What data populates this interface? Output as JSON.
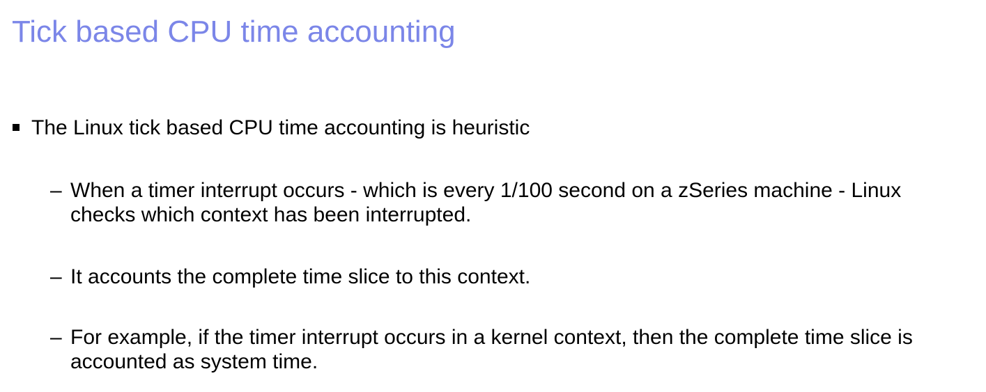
{
  "slide": {
    "title": "Tick based CPU time accounting",
    "title_color": "#7b86e8",
    "bullet": {
      "marker_icon": "square-bullet-icon",
      "text": "The Linux tick based CPU time accounting is heuristic",
      "sub_items": [
        {
          "dash": "–",
          "text": "When a timer interrupt occurs - which is every 1/100 second on a zSeries machine - Linux checks which context has been interrupted."
        },
        {
          "dash": "–",
          "text": "It accounts the complete time slice to this context."
        },
        {
          "dash": "–",
          "text": "For example, if the timer interrupt occurs in a kernel context, then the complete time slice is accounted as system time."
        }
      ]
    }
  }
}
